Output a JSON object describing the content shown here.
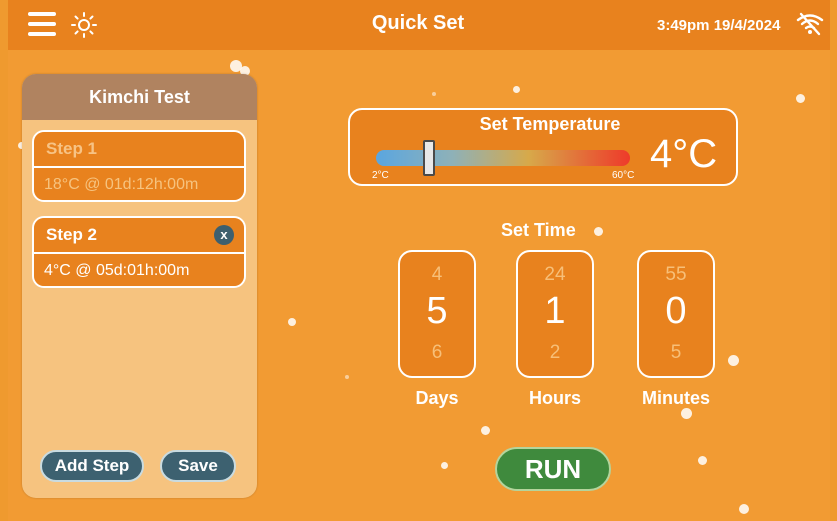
{
  "header": {
    "title": "Quick Set",
    "datetime": "3:49pm 19/4/2024",
    "menu_icon": "hamburger-menu-icon",
    "brightness_icon": "sun-icon",
    "wifi_icon": "wifi-off-icon"
  },
  "program": {
    "name": "Kimchi Test",
    "steps": [
      {
        "title": "Step 1",
        "detail": "18°C @ 01d:12h:00m"
      },
      {
        "title": "Step 2",
        "detail": "4°C @ 05d:01h:00m",
        "remove_label": "x"
      }
    ],
    "add_step_label": "Add Step",
    "save_label": "Save"
  },
  "temperature": {
    "title": "Set Temperature",
    "min_label": "2°C",
    "max_label": "60°C",
    "value_label": "4°C",
    "value": 4,
    "min": 2,
    "max": 60
  },
  "time": {
    "label": "Set Time",
    "days": {
      "prev": "4",
      "current": "5",
      "next": "6",
      "label": "Days"
    },
    "hours": {
      "prev": "24",
      "current": "1",
      "next": "2",
      "label": "Hours"
    },
    "minutes": {
      "prev": "55",
      "current": "0",
      "next": "5",
      "label": "Minutes"
    }
  },
  "run_label": "RUN",
  "colors": {
    "background": "#f29b33",
    "topbar": "#e8821e",
    "panel": "#f6c37f",
    "panel_header": "#b08360",
    "button": "#3d6170",
    "run": "#3f8a3d"
  }
}
